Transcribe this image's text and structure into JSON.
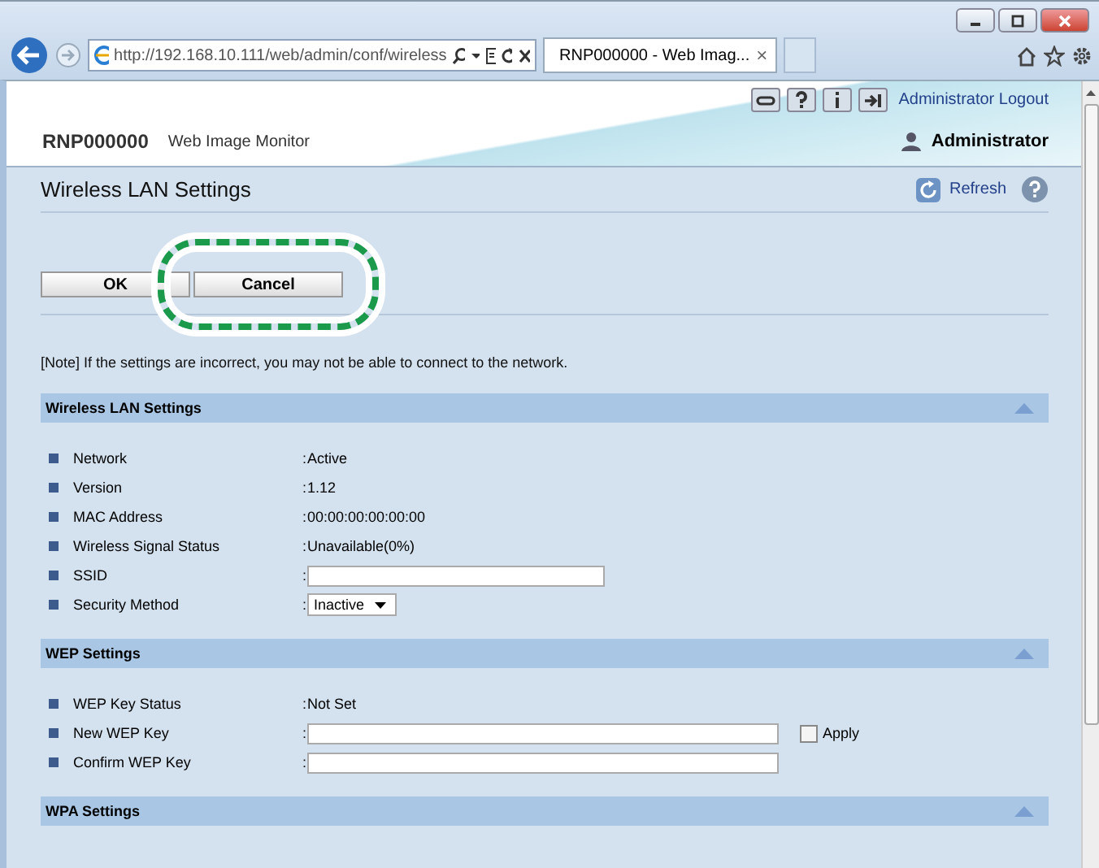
{
  "browser": {
    "address": "http://192.168.10.111/web/admin/conf/wireless",
    "tab_title": "RNP000000 - Web Imag...",
    "tab_close": "×"
  },
  "header": {
    "device": "RNP000000",
    "product": "Web Image Monitor",
    "logout": "Administrator Logout",
    "user": "Administrator"
  },
  "page": {
    "title": "Wireless LAN Settings",
    "refresh": "Refresh"
  },
  "buttons": [
    {
      "label": "OK",
      "highlighted": false
    },
    {
      "label": "Cancel",
      "highlighted": true
    }
  ],
  "note": "[Note] If the settings are incorrect, you may not be able to connect to the network.",
  "sections": [
    {
      "title": "Wireless LAN Settings",
      "rows": [
        {
          "kind": "text",
          "label": "Network",
          "separator": ":",
          "value": "Active"
        },
        {
          "kind": "text",
          "label": "Version",
          "separator": ":",
          "value": "1.12"
        },
        {
          "kind": "text",
          "label": "MAC Address",
          "separator": ":",
          "value": "00:00:00:00:00:00"
        },
        {
          "kind": "text",
          "label": "Wireless Signal Status",
          "separator": ":",
          "value": "Unavailable(0%)"
        },
        {
          "kind": "input",
          "label": "SSID",
          "separator": ":"
        },
        {
          "kind": "select",
          "label": "Security Method",
          "separator": ":",
          "value": "Inactive"
        }
      ]
    },
    {
      "title": "WEP Settings",
      "rows": [
        {
          "kind": "text",
          "label": "WEP Key Status",
          "separator": ":",
          "value": "Not Set"
        },
        {
          "kind": "wide-input",
          "label": "New WEP Key",
          "separator": ":",
          "check": {
            "label": "Apply",
            "checked": false
          }
        },
        {
          "kind": "wide-input",
          "label": "Confirm WEP Key",
          "separator": ":"
        }
      ]
    },
    {
      "title": "WPA Settings"
    }
  ]
}
